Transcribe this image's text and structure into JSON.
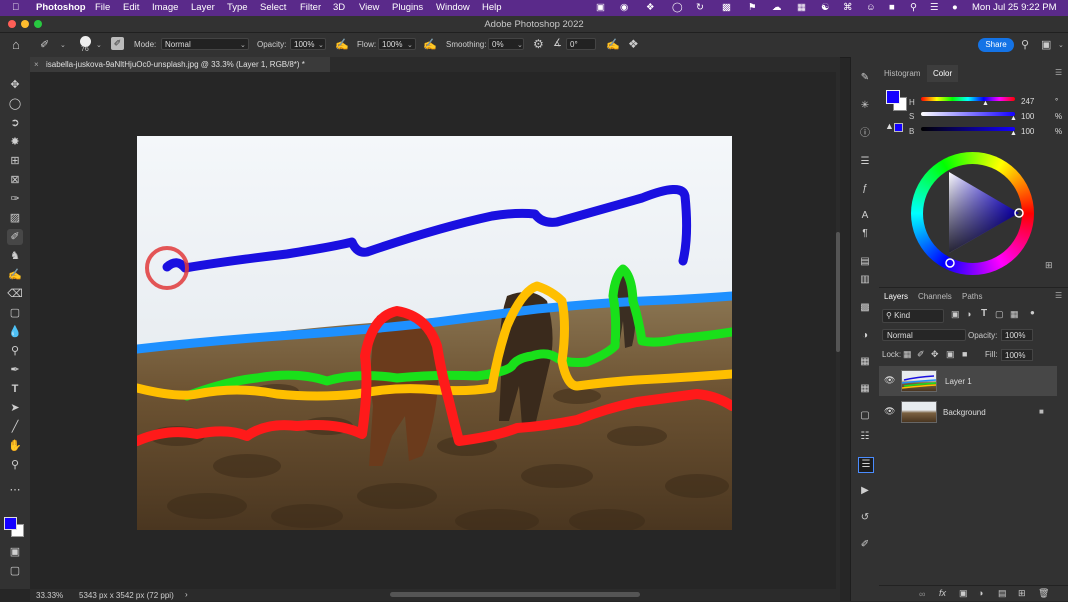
{
  "menubar": {
    "app": "Photoshop",
    "items": [
      "File",
      "Edit",
      "Image",
      "Layer",
      "Type",
      "Select",
      "Filter",
      "3D",
      "View",
      "Plugins",
      "Window",
      "Help"
    ],
    "clock": "Mon Jul 25  9:22 PM"
  },
  "window": {
    "title": "Adobe Photoshop 2022"
  },
  "options": {
    "brush_size": "76",
    "mode_label": "Mode:",
    "mode_value": "Normal",
    "opacity_label": "Opacity:",
    "opacity_value": "100%",
    "flow_label": "Flow:",
    "flow_value": "100%",
    "smoothing_label": "Smoothing:",
    "smoothing_value": "0%",
    "angle_value": "0°",
    "share_label": "Share"
  },
  "document": {
    "tab_label": "isabella-juskova-9aNltHjuOc0-unsplash.jpg @ 33.3% (Layer 1, RGB/8*) *",
    "zoom": "33.33%",
    "info": "5343 px x 3542 px (72 ppi)"
  },
  "color_panel": {
    "tabs": [
      "Histogram",
      "Color"
    ],
    "active_tab": "Color",
    "h_label": "H",
    "h_value": "247",
    "h_unit": "°",
    "s_label": "S",
    "s_value": "100",
    "s_unit": "%",
    "b_label": "B",
    "b_value": "100",
    "b_unit": "%",
    "foreground": "#1400ff",
    "background": "#ffffff"
  },
  "layers_panel": {
    "tabs": [
      "Layers",
      "Channels",
      "Paths"
    ],
    "active_tab": "Layers",
    "filter_label": "Kind",
    "blend_mode": "Normal",
    "opacity_label": "Opacity:",
    "opacity_value": "100%",
    "lock_label": "Lock:",
    "fill_label": "Fill:",
    "fill_value": "100%",
    "layers": [
      {
        "name": "Layer 1",
        "selected": true
      },
      {
        "name": "Background",
        "selected": false,
        "locked": true
      }
    ]
  },
  "strokes": {
    "colors": {
      "blue": "#1a10e0",
      "cyan": "#1e90ff",
      "green": "#19e01a",
      "yellow": "#ffbf00",
      "red": "#ff1a1a",
      "circle": "#e03a3a"
    }
  }
}
